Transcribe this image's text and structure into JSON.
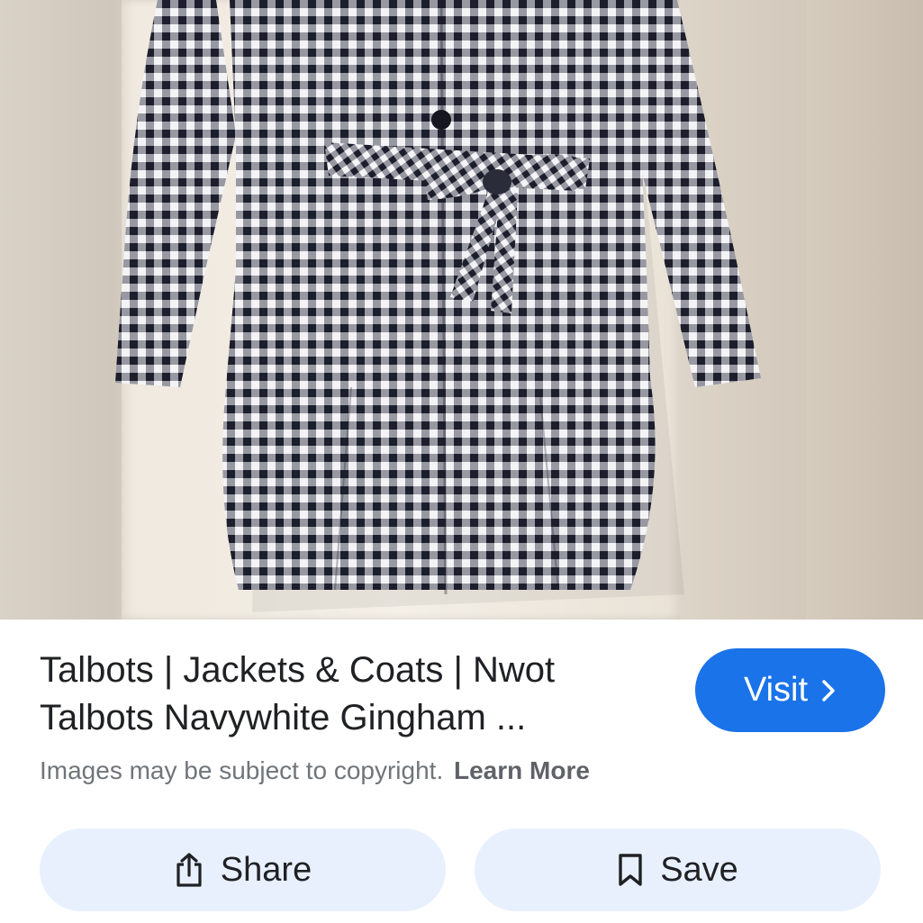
{
  "result": {
    "title": "Talbots | Jackets & Coats | Nwot Talbots Navywhite Gingham ...",
    "visit_label": "Visit",
    "copyright_text": "Images may be subject to copyright.",
    "learn_more_label": "Learn More"
  },
  "actions": {
    "share_label": "Share",
    "save_label": "Save"
  },
  "icons": {
    "visit": "chevron-right-icon",
    "share": "share-icon",
    "save": "bookmark-icon"
  },
  "colors": {
    "visit_button": "#1a73e8",
    "action_button_bg": "#e8f0fe",
    "title_text": "#202124",
    "muted_text": "#70757a"
  }
}
